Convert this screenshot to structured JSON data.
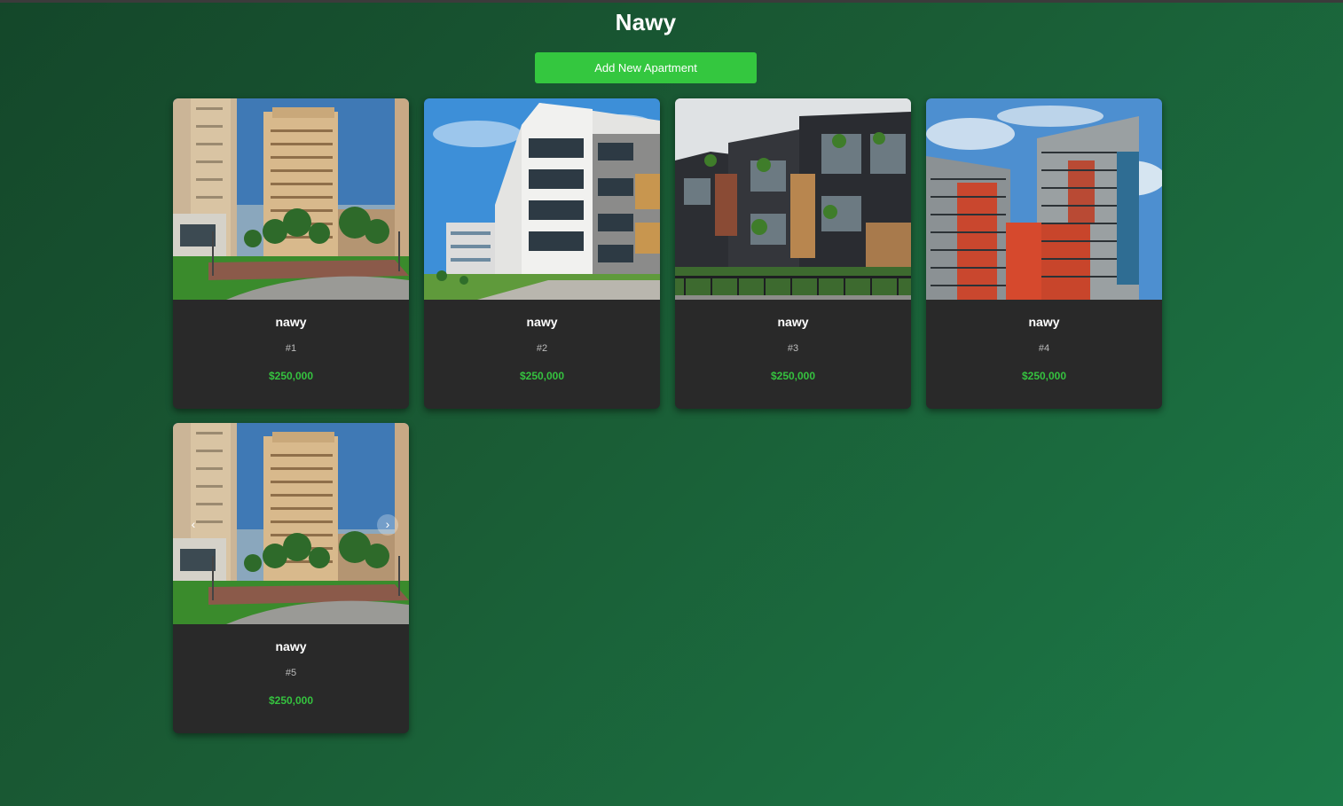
{
  "page": {
    "title": "Nawy"
  },
  "actions": {
    "add_label": "Add New Apartment"
  },
  "carousel": {
    "prev_glyph": "‹",
    "next_glyph": "›"
  },
  "apartments": [
    {
      "name": "nawy",
      "id_label": "#1",
      "price": "$250,000",
      "image": "tan-towers-photo"
    },
    {
      "name": "nawy",
      "id_label": "#2",
      "price": "$250,000",
      "image": "white-modern-apartment-photo"
    },
    {
      "name": "nawy",
      "id_label": "#3",
      "price": "$250,000",
      "image": "dark-townhouses-photo"
    },
    {
      "name": "nawy",
      "id_label": "#4",
      "price": "$250,000",
      "image": "red-grey-towers-photo"
    },
    {
      "name": "nawy",
      "id_label": "#5",
      "price": "$250,000",
      "image": "tan-towers-photo"
    }
  ],
  "colors": {
    "accent": "#34c73f",
    "price": "#35c23f",
    "card_bg": "#292929",
    "bg_dark": "#14472a",
    "bg_light": "#1c7a48"
  }
}
